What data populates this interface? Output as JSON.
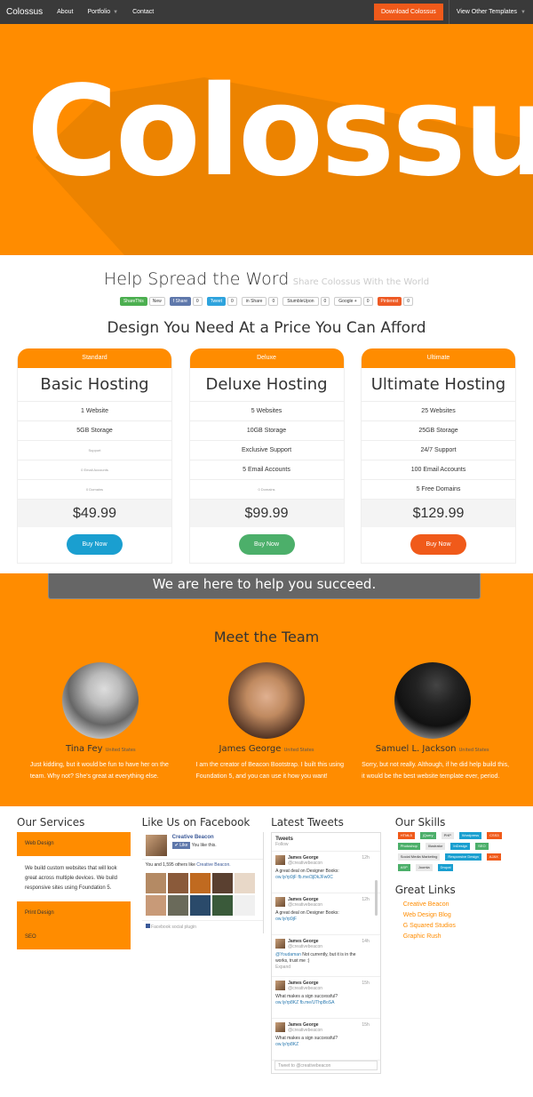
{
  "topbar": {
    "brand": "Colossus",
    "nav": [
      {
        "label": "About",
        "has_dropdown": false
      },
      {
        "label": "Portfolio",
        "has_dropdown": true
      },
      {
        "label": "Contact",
        "has_dropdown": false
      }
    ],
    "download_label": "Download Colossus",
    "other_label": "View Other Templates"
  },
  "hero": {
    "title": "Colossus"
  },
  "spread": {
    "heading": "Help Spread the Word",
    "subheading": "Share Colossus With the World",
    "buttons": [
      {
        "label": "ShareThis",
        "count": "New",
        "color": "#4caf50"
      },
      {
        "label": "f Share",
        "count": "0",
        "color": "#5f78ab"
      },
      {
        "label": "Tweet",
        "count": "0",
        "color": "#2ea3dd"
      },
      {
        "label": "in Share",
        "count": "0",
        "color": "#ffffff"
      },
      {
        "label": "StumbleUpon",
        "count": "0",
        "color": "#ffffff"
      },
      {
        "label": "Google +",
        "count": "0",
        "color": "#ffffff"
      },
      {
        "label": "Pinterest",
        "count": "0",
        "color": "#ee5a24"
      }
    ]
  },
  "pricing": {
    "tagline": "Design You Need At a Price You Can Afford",
    "plans": [
      {
        "tier": "Standard",
        "name": "Basic Hosting",
        "features": [
          "1 Website",
          "5GB Storage",
          "Support",
          "0 Email Accounts",
          "0 Domains"
        ],
        "price": "$49.99",
        "button": "Buy Now",
        "button_color": "#1a9fd0"
      },
      {
        "tier": "Deluxe",
        "name": "Deluxe Hosting",
        "features": [
          "5 Websites",
          "10GB Storage",
          "Exclusive Support",
          "5 Email Accounts",
          "0 Domains"
        ],
        "price": "$99.99",
        "button": "Buy Now",
        "button_color": "#4caf6a"
      },
      {
        "tier": "Ultimate",
        "name": "Ultimate Hosting",
        "features": [
          "25 Websites",
          "25GB Storage",
          "24/7 Support",
          "100 Email Accounts",
          "5 Free Domains"
        ],
        "price": "$129.99",
        "button": "Buy Now",
        "button_color": "#f05a1a"
      }
    ]
  },
  "banner": {
    "text": "We are here to help you succeed."
  },
  "team": {
    "title": "Meet the Team",
    "members": [
      {
        "name": "Tina Fey",
        "location": "United States",
        "bio": "Just kidding, but it would be fun to have her on the team. Why not? She's great at everything else."
      },
      {
        "name": "James George",
        "location": "United States",
        "bio": "I am the creator of Beacon Bootstrap. I built this using Foundation 5, and you can use it how you want!"
      },
      {
        "name": "Samuel L. Jackson",
        "location": "United States",
        "bio": "Sorry, but not really. Although, if he did help build this, it would be the best website template ever, period."
      }
    ]
  },
  "services": {
    "title": "Our Services",
    "items": [
      {
        "label": "Web Design",
        "text": "We build custom websites that will look great across multiple devices. We build responsive sites using Foundation 5."
      },
      {
        "label": "Print Design"
      },
      {
        "label": "SEO"
      }
    ]
  },
  "facebook": {
    "title": "Like Us on Facebook",
    "page_name": "Creative Beacon",
    "like_label": "Like",
    "you_like": "You like this.",
    "others": "You and 1,595 others like",
    "others_link": "Creative Beacon.",
    "plugin_label": "Facebook social plugin"
  },
  "tweets": {
    "title": "Latest Tweets",
    "header": "Tweets",
    "follow": "Follow",
    "items": [
      {
        "name": "James George",
        "handle": "@creativebeacon",
        "time": "12h",
        "text": "A great deal on Designer Books:",
        "link": "ow.ly/rp9jF fb.me/3jDkJFw0C"
      },
      {
        "name": "James George",
        "handle": "@creativebeacon",
        "time": "12h",
        "text": "A great deal on Designer Books:",
        "link": "ow.ly/rp9jF"
      },
      {
        "name": "James George",
        "handle": "@creativebeacon",
        "time": "14h",
        "mention": "@Youdaman",
        "text": "Not currently, but it is in the works, trust me :)",
        "expand": "Expand"
      },
      {
        "name": "James George",
        "handle": "@creativebeacon",
        "time": "15h",
        "text": "What makes a sign successful?",
        "link": "ow.ly/rp8KZ fb.me/UThpBoSA"
      },
      {
        "name": "James George",
        "handle": "@creativebeacon",
        "time": "15h",
        "text": "What makes a sign successful?",
        "link": "ow.ly/rp8KZ"
      }
    ],
    "input_placeholder": "Tweet to @creativebeacon"
  },
  "skills": {
    "title": "Our Skills",
    "tags": [
      {
        "label": "HTML5",
        "color": "#f05a1a"
      },
      {
        "label": "jQuery",
        "color": "#4caf6a"
      },
      {
        "label": "PHP",
        "color": "#e8e8e8"
      },
      {
        "label": "Wordpress",
        "color": "#1a9fd0"
      },
      {
        "label": "CSS3",
        "color": "#f05a1a"
      },
      {
        "label": "Photoshop",
        "color": "#4caf6a"
      },
      {
        "label": "Illustrator",
        "color": "#e8e8e8"
      },
      {
        "label": "InDesign",
        "color": "#1a9fd0"
      },
      {
        "label": "SEO",
        "color": "#4caf6a"
      },
      {
        "label": "Social Media Marketing",
        "color": "#e8e8e8"
      },
      {
        "label": "Responsive Design",
        "color": "#1a9fd0"
      },
      {
        "label": "AJAX",
        "color": "#f05a1a"
      },
      {
        "label": "ASP",
        "color": "#4caf6a"
      },
      {
        "label": "Joomla",
        "color": "#e8e8e8"
      },
      {
        "label": "Drupal",
        "color": "#1a9fd0"
      }
    ]
  },
  "great_links": {
    "title": "Great Links",
    "items": [
      "Creative Beacon",
      "Web Design Blog",
      "G Squared Studios",
      "Graphic Rush"
    ]
  },
  "colors": {
    "brand_orange": "#ff8c00",
    "accent": "#f05a1a",
    "dark": "#3a3a3a"
  }
}
